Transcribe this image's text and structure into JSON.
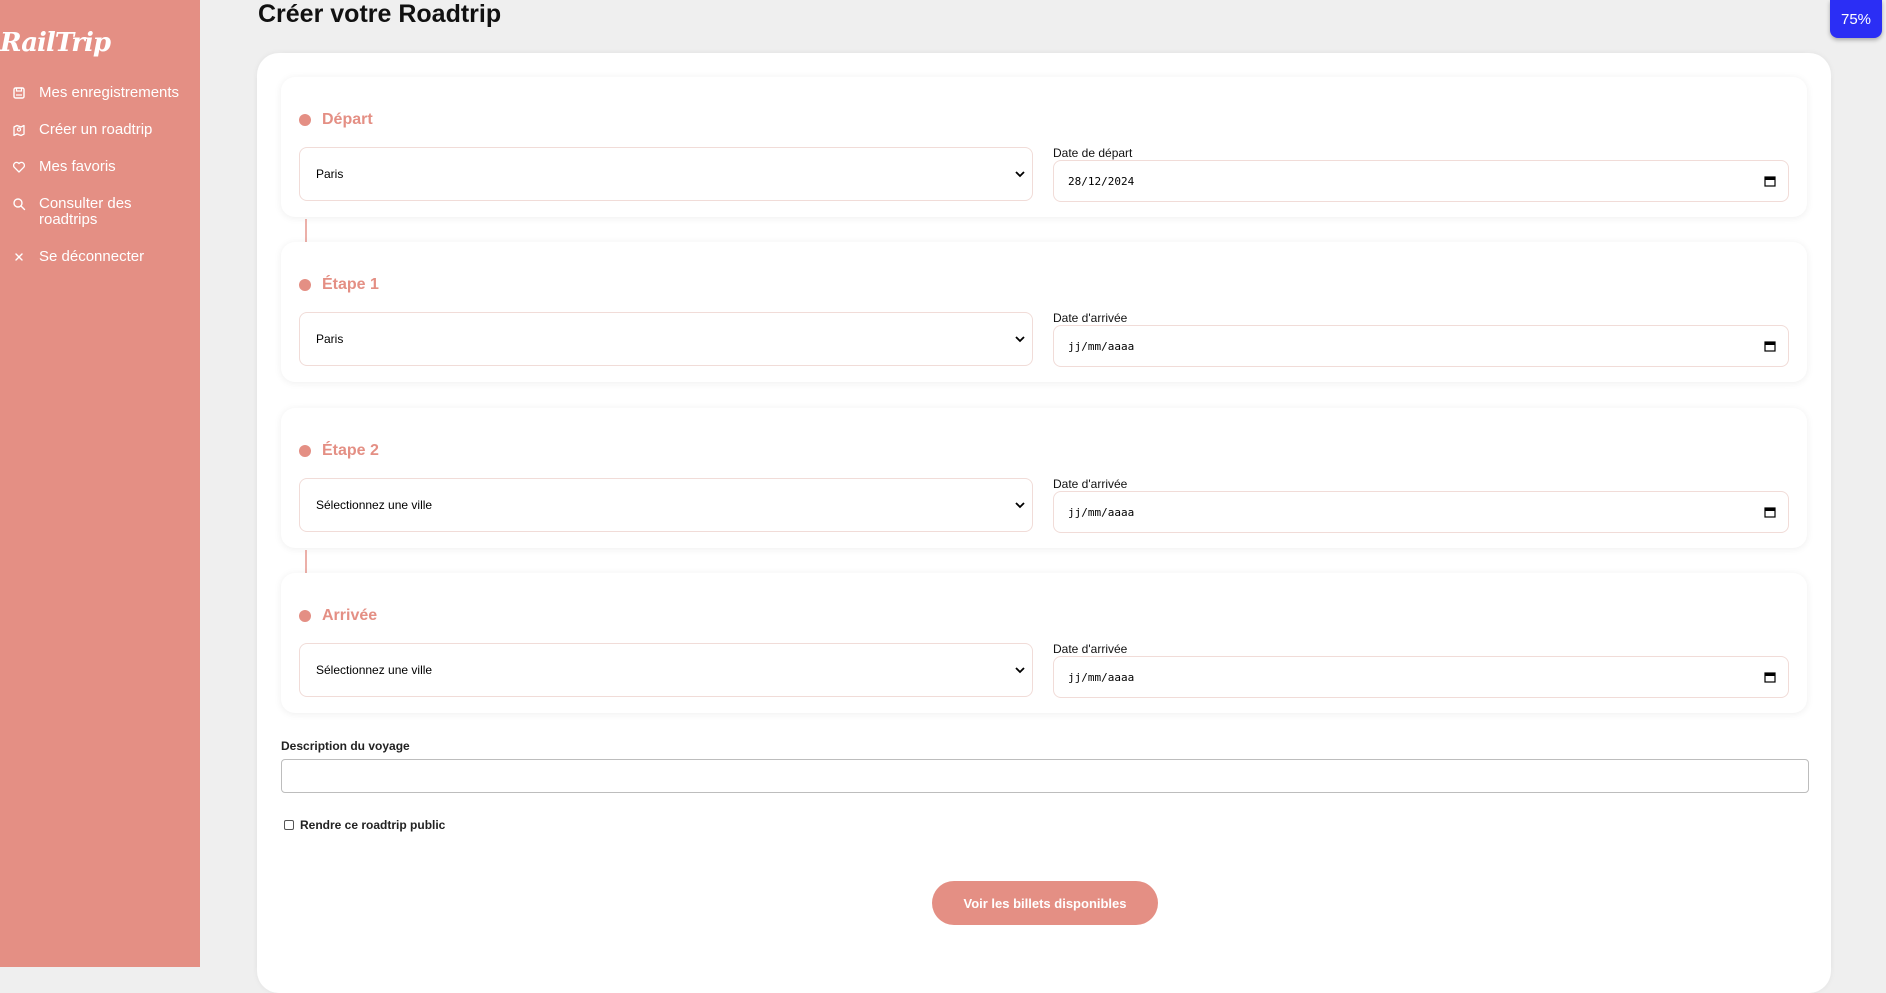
{
  "app": {
    "logo": "RailTrip"
  },
  "sidebar": {
    "items": [
      {
        "label": "Mes enregistrements",
        "icon": "save-icon"
      },
      {
        "label": "Créer un roadtrip",
        "icon": "map-icon"
      },
      {
        "label": "Mes favoris",
        "icon": "heart-icon"
      },
      {
        "label": "Consulter des roadtrips",
        "icon": "search-icon"
      },
      {
        "label": "Se déconnecter",
        "icon": "close-icon"
      }
    ]
  },
  "zoom": {
    "level": "75%"
  },
  "page": {
    "title": "Créer votre Roadtrip"
  },
  "stages": [
    {
      "title": "Départ",
      "city": "Paris",
      "date_label": "Date de départ",
      "date_value": "28/12/2024"
    },
    {
      "title": "Étape 1",
      "city": "Paris",
      "date_label": "Date d'arrivée",
      "date_value": "jj/mm/aaaa"
    },
    {
      "title": "Étape 2",
      "city": "Sélectionnez une ville",
      "date_label": "Date d'arrivée",
      "date_value": "jj/mm/aaaa"
    },
    {
      "title": "Arrivée",
      "city": "Sélectionnez une ville",
      "date_label": "Date d'arrivée",
      "date_value": "jj/mm/aaaa"
    }
  ],
  "description": {
    "label": "Description du voyage",
    "value": ""
  },
  "public": {
    "label": "Rendre ce roadtrip public",
    "checked": false
  },
  "cta": {
    "label": "Voir les billets disponibles"
  },
  "colors": {
    "accent": "#e48f84",
    "zoom_badge": "#2b2ef5",
    "background": "#efefef"
  }
}
